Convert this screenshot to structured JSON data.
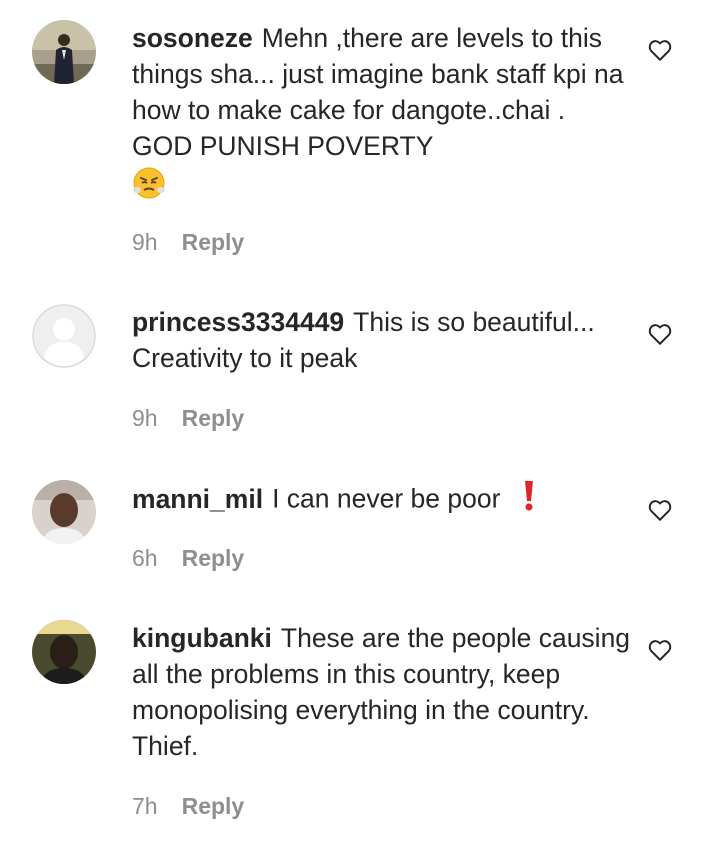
{
  "comments": [
    {
      "username": "sosoneze",
      "text": "Mehn ,there are levels to this things sha... just imagine bank staff kpi na how to make cake for dangote..chai . GOD PUNISH POVERTY",
      "emoji": "😤",
      "time": "9h",
      "reply_label": "Reply",
      "avatar_icon": "avatar-man-suit"
    },
    {
      "username": "princess3334449",
      "text": "This is so beautiful... Creativity to it peak",
      "time": "9h",
      "reply_label": "Reply",
      "avatar_icon": "avatar-default-placeholder"
    },
    {
      "username": "manni_mil",
      "text": "I can never be poor",
      "emoji": "❗",
      "time": "6h",
      "reply_label": "Reply",
      "avatar_icon": "avatar-man-white-shirt"
    },
    {
      "username": "kingubanki",
      "text": "These are the people causing all the problems in this country, keep monopolising everything in the country. Thief.",
      "time": "7h",
      "reply_label": "Reply",
      "avatar_icon": "avatar-man-dark"
    }
  ],
  "colors": {
    "text": "#262626",
    "secondary": "#8e8e8e",
    "emoji_red": "#e0242a"
  }
}
